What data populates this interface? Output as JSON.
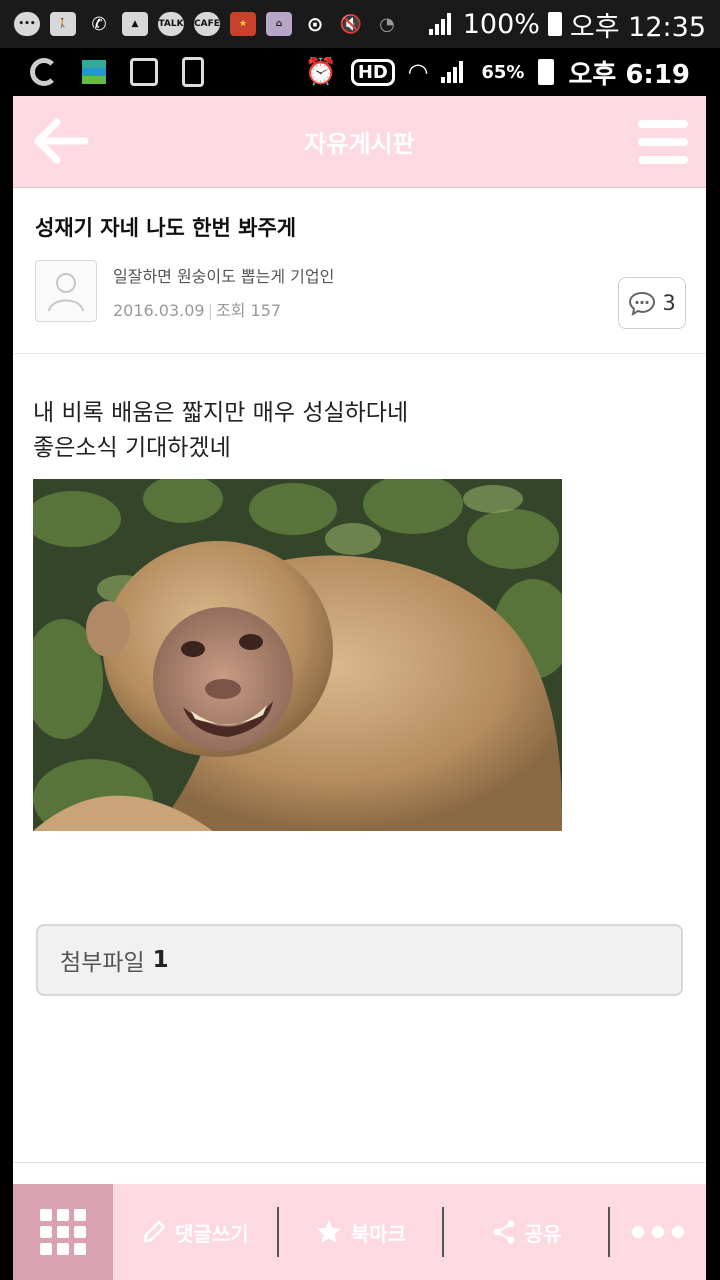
{
  "status_bar": {
    "battery_percent": "100%",
    "time": "오후 12:35",
    "notif_icons": [
      "walk-icon",
      "missed-call-icon",
      "gallery-icon",
      "talk-icon",
      "cafe-icon",
      "game-icon",
      "bag-icon",
      "sync-icon",
      "mute-icon",
      "wifi-icon",
      "signal-icon"
    ],
    "talk_label": "TALK",
    "cafe_label": "CAFE"
  },
  "status_bar_2": {
    "hd_label": "HD",
    "battery_percent": "65%",
    "time": "오후 6:19"
  },
  "app_bar": {
    "title": "자유게시판"
  },
  "post": {
    "title": "성재기 자네 나도 한번 봐주게",
    "author": "일잘하면 원숭이도 뽑는게 기업인",
    "date": "2016.03.09",
    "views_label": "조회",
    "views": "157",
    "comment_count": "3",
    "body_line_1": "내 비록 배움은 짧지만 매우 성실하다네",
    "body_line_2": "좋은소식 기대하겠네"
  },
  "attachment": {
    "label": "첨부파일",
    "count": "1"
  },
  "bottom_bar": {
    "write_comment": "댓글쓰기",
    "bookmark": "북마크",
    "share": "공유"
  },
  "colors": {
    "accent_pink": "#fdd9e2",
    "grid_button": "#d8a2b0"
  }
}
